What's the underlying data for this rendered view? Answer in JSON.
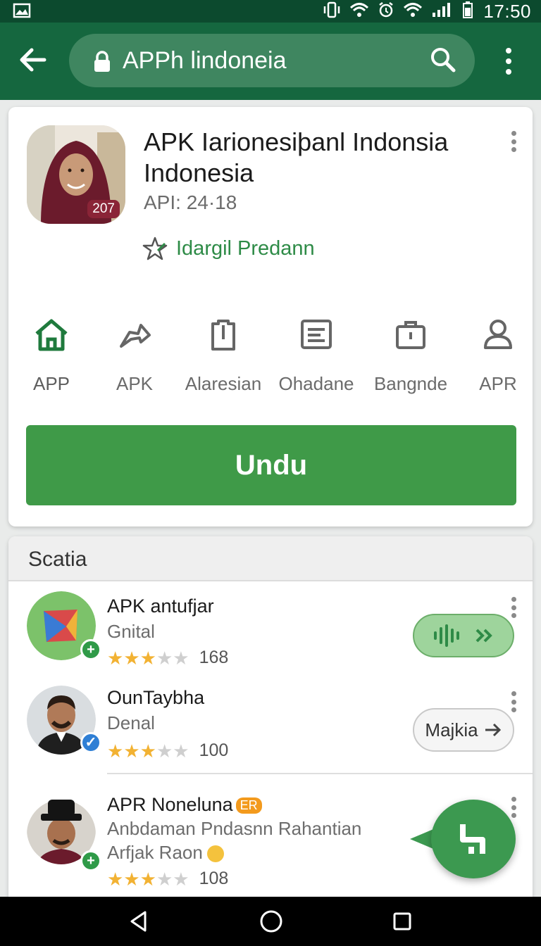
{
  "status_bar": {
    "time": "17:50",
    "icons": [
      "image-icon",
      "vibrate-icon",
      "wifi-icon",
      "alarm-icon",
      "wifi-icon",
      "signal-icon",
      "battery-icon"
    ]
  },
  "app_bar": {
    "search_text": "APPh lindoneia",
    "icons": [
      "back-arrow-icon",
      "lock-icon",
      "search-icon",
      "more-vert-icon"
    ]
  },
  "app_card": {
    "title": "APK Iarionesiþanl Indonsia Indonesia",
    "version": "API: 24·18",
    "icon_badge": "207",
    "developer": "Idargil Predann",
    "developer_icon": "editor-choice-icon",
    "actions": [
      {
        "label": "APP",
        "icon": "home-icon"
      },
      {
        "label": "APK",
        "icon": "share-arrow-icon"
      },
      {
        "label": "Alaresian",
        "icon": "document-icon"
      },
      {
        "label": "Ohadane",
        "icon": "list-icon"
      },
      {
        "label": "Bangnde",
        "icon": "bag-icon"
      },
      {
        "label": "APR",
        "icon": "person-icon"
      }
    ],
    "download_label": "Undu"
  },
  "list": {
    "header": "Scatia",
    "items": [
      {
        "name": "APK antufjar",
        "sub": "Gnital",
        "rating": 3,
        "rating_max": 5,
        "count": "168",
        "button_icon": "soundwave-icon"
      },
      {
        "name": "OunTaybha",
        "sub": "Denal",
        "rating": 3,
        "rating_max": 5,
        "count": "100",
        "button_label": "Majkia"
      },
      {
        "name": "APR Noneluna",
        "tag": "ER",
        "sub": "Anbdaman Pndasnn Rahantian",
        "sub2": "Arfjak Raon",
        "rating": 3,
        "rating_max": 5,
        "count": "108"
      }
    ]
  },
  "colors": {
    "status_bar": "#0c4a2e",
    "app_bar": "#15673f",
    "accent": "#3f9a48",
    "star": "#f2b233"
  },
  "nav_bar": {
    "icons": [
      "back-triangle-icon",
      "home-circle-icon",
      "recents-square-icon"
    ]
  }
}
